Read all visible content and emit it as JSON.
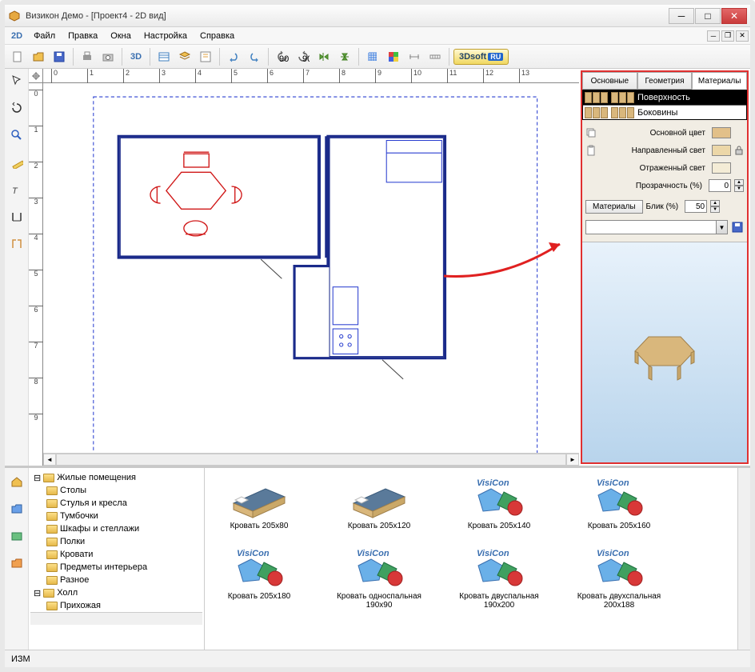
{
  "window": {
    "title": "Визикон Демо - [Проект4 - 2D вид]"
  },
  "menu": {
    "mode": "2D",
    "items": [
      "Файл",
      "Правка",
      "Окна",
      "Настройка",
      "Справка"
    ]
  },
  "toolbar": {
    "btn3d": "3D",
    "logo": "3Dsoft",
    "logo_ru": "RU"
  },
  "ruler": {
    "h": [
      "0",
      "1",
      "2",
      "3",
      "4",
      "5",
      "6",
      "7",
      "8",
      "9",
      "10",
      "11",
      "12",
      "13"
    ],
    "v": [
      "0",
      "1",
      "2",
      "3",
      "4",
      "5",
      "6",
      "7",
      "8",
      "9"
    ]
  },
  "props": {
    "tabs": [
      "Основные",
      "Геометрия",
      "Материалы"
    ],
    "active_tab": 2,
    "surfaces": [
      "Поверхность",
      "Боковины"
    ],
    "labels": {
      "main_color": "Основной цвет",
      "dir_light": "Направленный свет",
      "refl_light": "Отраженный свет",
      "transparency": "Прозрачность (%)",
      "materials_btn": "Материалы",
      "glare": "Блик (%)"
    },
    "values": {
      "transparency": "0",
      "glare": "50"
    }
  },
  "tree": {
    "root": "Жилые помещения",
    "children": [
      "Столы",
      "Стулья и кресла",
      "Тумбочки",
      "Шкафы и стеллажи",
      "Полки",
      "Кровати",
      "Предметы интерьера",
      "Разное"
    ],
    "root2": "Холл",
    "children2": [
      "Прихожая"
    ]
  },
  "library": {
    "items": [
      {
        "label": "Кровать 205x80",
        "type": "bed"
      },
      {
        "label": "Кровать 205x120",
        "type": "bed"
      },
      {
        "label": "Кровать 205x140",
        "type": "visicon"
      },
      {
        "label": "Кровать 205x160",
        "type": "visicon"
      },
      {
        "label": "Кровать 205x180",
        "type": "visicon"
      },
      {
        "label": "Кровать односпальная 190x90",
        "type": "visicon"
      },
      {
        "label": "Кровать двуспальная 190x200",
        "type": "visicon"
      },
      {
        "label": "Кровать двухспальная 200x188",
        "type": "visicon"
      }
    ],
    "visicon_text": "VisiCon"
  },
  "status": {
    "mode": "ИЗМ"
  }
}
